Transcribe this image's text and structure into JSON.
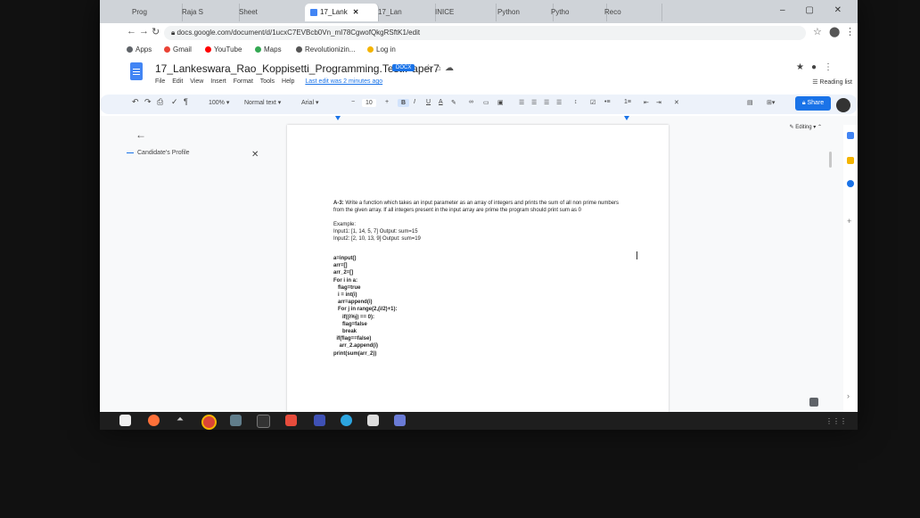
{
  "browser": {
    "tabs": [
      {
        "label": "Prog"
      },
      {
        "label": "Raja S"
      },
      {
        "label": "Sheet"
      },
      {
        "label": "17_Lank",
        "active": true
      },
      {
        "label": "17_Lan"
      },
      {
        "label": "INICE"
      },
      {
        "label": "Python"
      },
      {
        "label": "Pytho"
      },
      {
        "label": "Reco"
      }
    ],
    "url": "docs.google.com/document/d/1ucxC7EVBcb0Vn_mI78CgwofQkgRSftK1/edit",
    "bookmarks": [
      {
        "label": "Apps",
        "icon": "apps-icon",
        "color": "#5f6368"
      },
      {
        "label": "Gmail",
        "icon": "gmail-icon",
        "color": "#ea4335"
      },
      {
        "label": "YouTube",
        "icon": "youtube-icon",
        "color": "#ff0000"
      },
      {
        "label": "Maps",
        "icon": "maps-icon",
        "color": "#34a853"
      },
      {
        "label": "Revolutionizin...",
        "icon": "bookmark-icon",
        "color": "#555555"
      },
      {
        "label": "Log in",
        "icon": "key-icon",
        "color": "#f4b400"
      }
    ],
    "reading_list": "Reading list"
  },
  "docs": {
    "title": "17_Lankeswara_Rao_Koppisetti_Programming.Test.Paper7",
    "badge": "DOCX",
    "menu": [
      "File",
      "Edit",
      "View",
      "Insert",
      "Format",
      "Tools",
      "Help"
    ],
    "last_edit": "Last edit was 2 minutes ago",
    "share_label": "Share",
    "editing_label": "Editing",
    "toolbar": {
      "zoom": "100%",
      "style": "Normal text",
      "font": "Arial",
      "font_size": "10",
      "bold": "B",
      "italic": "I",
      "underline": "U",
      "text_color": "A"
    },
    "outline": {
      "item": "Candidate's Profile"
    },
    "content": {
      "question_label": "A-3:",
      "question_text": "Write a function which takes an input parameter as an array of integers and prints the sum of all non prime numbers from the given array. If all integers present in the input array are prime the program should print sum as 0",
      "example_heading": "Example:",
      "example_1": "Input1: [1, 14, 5, 7] Output: sum=15",
      "example_2": "Input2: [2, 10, 13, 9] Output: sum=19",
      "code_block_1": "a=input()\narr=[]\narr_2=[]",
      "code_block_2": "For i in a:\n   flag=true\n   i = int(i)\n   arr=append(i)\n   For j in range(2,(i/2)+1):\n      if((i%j) == 0):\n      flag=false\n      break",
      "code_block_3": "  if(flag==false)\n    arr_2.append(i)\nprint(sum(arr_2))"
    }
  },
  "colors": {
    "accent": "#1a73e8",
    "docs_blue": "#4285f4"
  }
}
